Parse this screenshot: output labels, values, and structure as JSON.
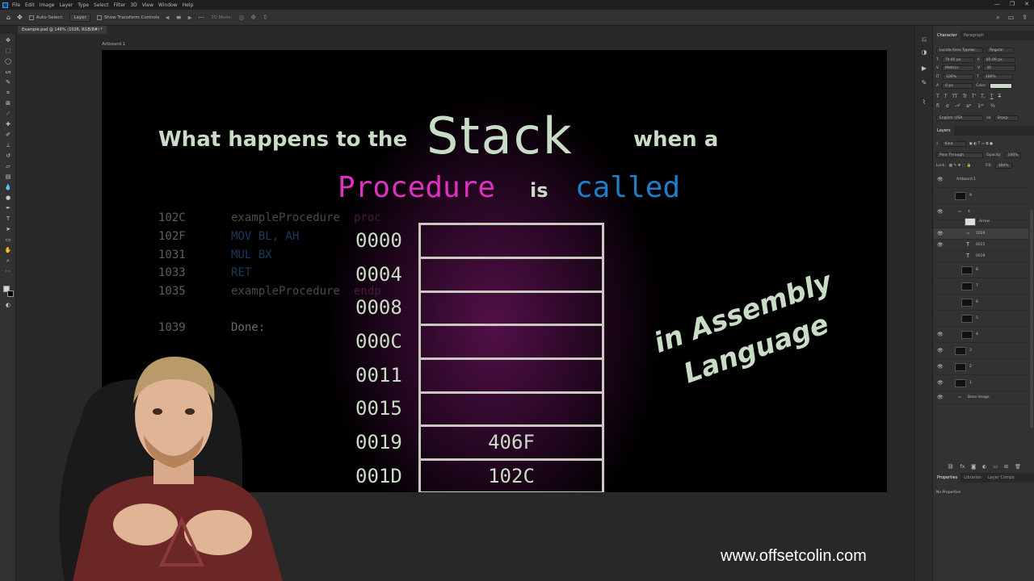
{
  "menubar": {
    "items": [
      "File",
      "Edit",
      "Image",
      "Layer",
      "Type",
      "Select",
      "Filter",
      "3D",
      "View",
      "Window",
      "Help"
    ]
  },
  "options": {
    "auto_select": "Auto-Select:",
    "layer_select": "Layer",
    "show_transform": "Show Transform Controls",
    "mode_3d": "3D Mode:"
  },
  "document": {
    "tab_title": "Example.psd @ 146% (1026, RGB/8#) *",
    "artboard_label": "Artboard 1"
  },
  "slide": {
    "line1_left": "What happens to the",
    "line1_stack": "Stack",
    "line1_right": "when a",
    "word_procedure": "Procedure",
    "word_is": "is",
    "word_called": "called",
    "side_line1": "in Assembly",
    "side_line2": "Language",
    "code": [
      {
        "addr": "102C",
        "text": "exampleProcedure",
        "extra": "proc"
      },
      {
        "addr": "102F",
        "text": "MOV BL, AH",
        "extra": ""
      },
      {
        "addr": "1031",
        "text": "MUL BX",
        "extra": ""
      },
      {
        "addr": "1033",
        "text": "RET",
        "extra": ""
      },
      {
        "addr": "1035",
        "text": "exampleProcedure",
        "extra": "endp"
      },
      {
        "addr": "1039",
        "text": "Done:",
        "extra": ""
      }
    ],
    "stack_addresses": [
      "0000",
      "0004",
      "0008",
      "000C",
      "0011",
      "0015",
      "0019",
      "001D"
    ],
    "stack_values": [
      "",
      "",
      "",
      "",
      "",
      "",
      "406F",
      "102C"
    ],
    "colors": {
      "title": "#c9dcc5",
      "procedure": "#e030c0",
      "called": "#1e7fc8",
      "stack_border": "#c9c9c0"
    }
  },
  "character_panel": {
    "tabs": [
      "Character",
      "Paragraph"
    ],
    "font_family": "Lucida Sans Typewr...",
    "font_style": "Regular",
    "font_size": "70.85 px",
    "leading": "85.09 px",
    "kerning": "Metrics",
    "tracking": "30",
    "vscale": "100%",
    "hscale": "100%",
    "baseline": "0 px",
    "color_label": "Color:",
    "language": "English: USA",
    "antialias": "Sharp",
    "type_buttons": [
      "T",
      "T",
      "TT",
      "Tr",
      "T'",
      "T,",
      "T",
      "T"
    ]
  },
  "layers_panel": {
    "title": "Layers",
    "kind": "Kind",
    "blend": "Pass Through",
    "opacity_label": "Opacity:",
    "opacity": "100%",
    "lock_label": "Lock:",
    "fill_label": "Fill:",
    "fill": "100%",
    "layers": [
      {
        "name": "Artboard 1",
        "type": "artboard"
      },
      {
        "name": "9",
        "type": "image"
      },
      {
        "name": "4",
        "type": "group"
      },
      {
        "name": "Arrow",
        "type": "image"
      },
      {
        "name": "1026",
        "type": "group"
      },
      {
        "name": "0015",
        "type": "text"
      },
      {
        "name": "0019",
        "type": "text"
      },
      {
        "name": "8",
        "type": "image"
      },
      {
        "name": "7",
        "type": "image"
      },
      {
        "name": "6",
        "type": "image"
      },
      {
        "name": "5",
        "type": "image"
      },
      {
        "name": "4",
        "type": "image"
      },
      {
        "name": "3",
        "type": "image"
      },
      {
        "name": "2",
        "type": "image"
      },
      {
        "name": "1",
        "type": "image"
      },
      {
        "name": "Base Image",
        "type": "group"
      }
    ]
  },
  "properties_panel": {
    "tabs": [
      "Properties",
      "Libraries",
      "Layer Comps"
    ],
    "empty_text": "No Properties"
  },
  "watermark": "www.offsetcolin.com"
}
